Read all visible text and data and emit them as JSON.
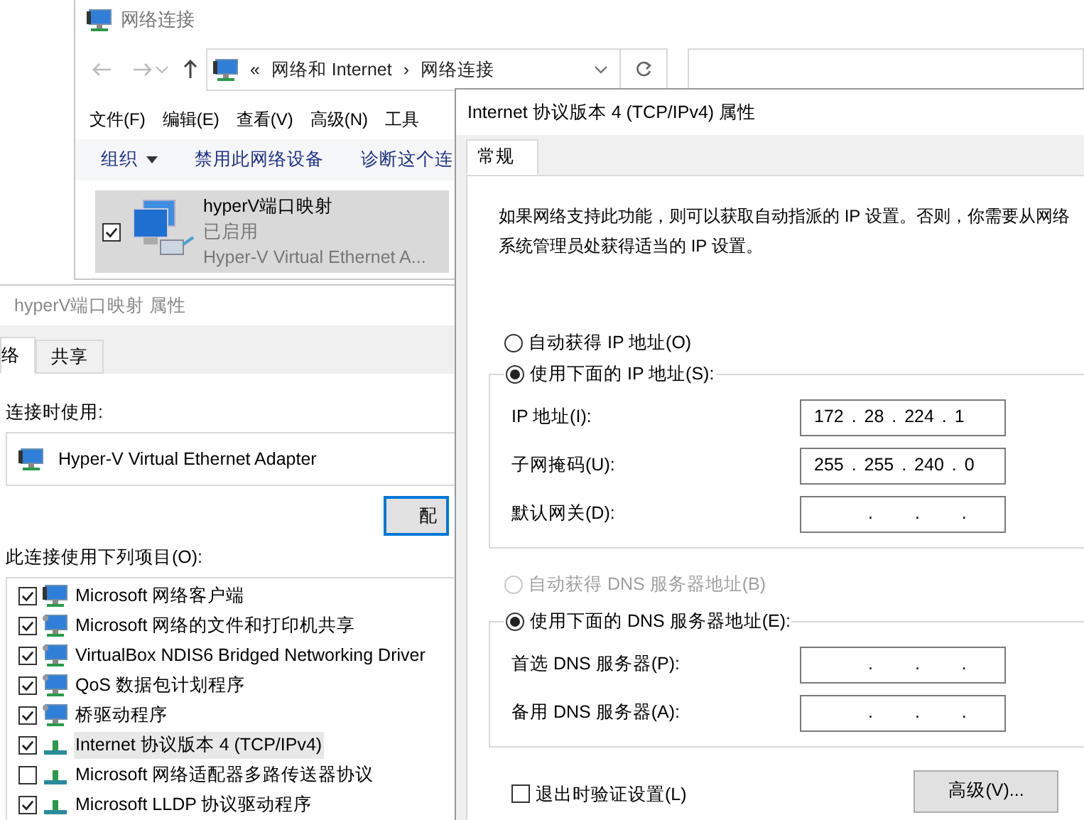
{
  "explorer": {
    "title": "网络连接",
    "breadcrumb": [
      "«",
      "网络和 Internet",
      "›",
      "网络连接"
    ],
    "menu": [
      "文件(F)",
      "编辑(E)",
      "查看(V)",
      "高级(N)",
      "工具"
    ],
    "commands": [
      {
        "label": "组织",
        "dropdown": true
      },
      {
        "label": "禁用此网络设备",
        "dropdown": false
      },
      {
        "label": "诊断这个连",
        "dropdown": false
      }
    ],
    "adapter": {
      "name": "hyperV端口映射",
      "status": "已启用",
      "device": "Hyper-V Virtual Ethernet A...",
      "checked": true,
      "selected": true
    }
  },
  "properties_dialog": {
    "title": "hyperV端口映射 属性",
    "tabs": [
      {
        "label": "络",
        "selected": true
      },
      {
        "label": "共享",
        "selected": false
      }
    ],
    "connect_using_label": "连接时使用:",
    "adapter_name": "Hyper-V Virtual Ethernet Adapter",
    "configure_button": "配",
    "items_label": "此连接使用下列项目(O):",
    "items": [
      {
        "kind": "client",
        "label": "Microsoft 网络客户端",
        "checked": true,
        "selected": false
      },
      {
        "kind": "service",
        "label": "Microsoft 网络的文件和打印机共享",
        "checked": true,
        "selected": false
      },
      {
        "kind": "service",
        "label": "VirtualBox NDIS6 Bridged Networking Driver",
        "checked": true,
        "selected": false
      },
      {
        "kind": "service",
        "label": "QoS 数据包计划程序",
        "checked": true,
        "selected": false
      },
      {
        "kind": "service",
        "label": "桥驱动程序",
        "checked": true,
        "selected": false
      },
      {
        "kind": "protocol",
        "label": "Internet 协议版本 4 (TCP/IPv4)",
        "checked": true,
        "selected": true
      },
      {
        "kind": "protocol",
        "label": "Microsoft 网络适配器多路传送器协议",
        "checked": false,
        "selected": false
      },
      {
        "kind": "protocol",
        "label": "Microsoft LLDP 协议驱动程序",
        "checked": true,
        "selected": false
      }
    ]
  },
  "ipv4_dialog": {
    "title": "Internet 协议版本 4 (TCP/IPv4) 属性",
    "tabs": [
      {
        "label": "常规",
        "selected": true
      }
    ],
    "description": "如果网络支持此功能，则可以获取自动指派的 IP 设置。否则，你需要从网络系统管理员处获得适当的 IP 设置。",
    "ip_mode": [
      {
        "label": "自动获得 IP 地址(O)",
        "selected": false,
        "disabled": false
      },
      {
        "label": "使用下面的 IP 地址(S):",
        "selected": true,
        "disabled": false
      }
    ],
    "ip_fields": [
      {
        "label": "IP 地址(I):",
        "value": "172 . 28 . 224 . 1",
        "kind": "filled"
      },
      {
        "label": "子网掩码(U):",
        "value": "255 . 255 . 240 . 0",
        "kind": "filled"
      },
      {
        "label": "默认网关(D):",
        "value": ". . .",
        "kind": "blank"
      }
    ],
    "dns_mode": [
      {
        "label": "自动获得 DNS 服务器地址(B)",
        "selected": false,
        "disabled": true
      },
      {
        "label": "使用下面的 DNS 服务器地址(E):",
        "selected": true,
        "disabled": false
      }
    ],
    "dns_fields": [
      {
        "label": "首选 DNS 服务器(P):",
        "value": ". . .",
        "kind": "blank"
      },
      {
        "label": "备用 DNS 服务器(A):",
        "value": ". . .",
        "kind": "blank"
      }
    ],
    "validate_on_exit": {
      "label": "退出时验证设置(L)",
      "checked": false
    },
    "advanced_button": "高级(V)..."
  }
}
